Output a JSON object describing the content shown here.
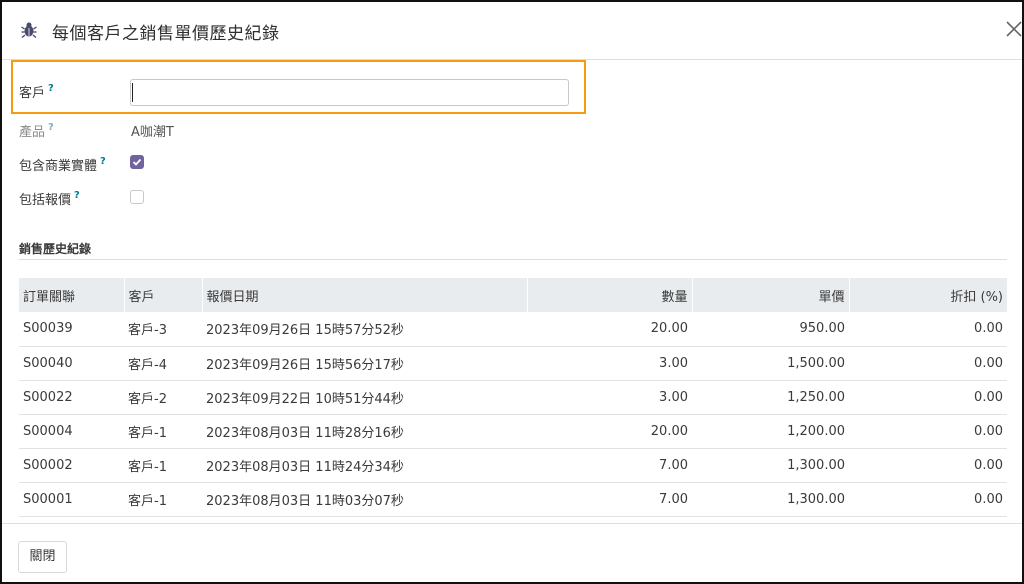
{
  "dialog": {
    "title": "每個客戶之銷售單價歷史紀錄"
  },
  "form": {
    "customer_label": "客戶",
    "customer_value": "",
    "product_label": "產品",
    "product_value": "A咖潮T",
    "include_company_label": "包含商業實體",
    "include_company_checked": true,
    "include_quotes_label": "包括報價",
    "include_quotes_checked": false,
    "help_mark": "?"
  },
  "history": {
    "section_title": "銷售歷史紀錄",
    "columns": [
      "訂單關聯",
      "客戶",
      "報價日期",
      "數量",
      "單價",
      "折扣 (%)"
    ],
    "rows": [
      {
        "order": "S00039",
        "customer": "客戶-3",
        "date": "2023年09月26日 15時57分52秒",
        "qty": "20.00",
        "price": "950.00",
        "discount": "0.00"
      },
      {
        "order": "S00040",
        "customer": "客戶-4",
        "date": "2023年09月26日 15時56分17秒",
        "qty": "3.00",
        "price": "1,500.00",
        "discount": "0.00"
      },
      {
        "order": "S00022",
        "customer": "客戶-2",
        "date": "2023年09月22日 10時51分44秒",
        "qty": "3.00",
        "price": "1,250.00",
        "discount": "0.00"
      },
      {
        "order": "S00004",
        "customer": "客戶-1",
        "date": "2023年08月03日 11時28分16秒",
        "qty": "20.00",
        "price": "1,200.00",
        "discount": "0.00"
      },
      {
        "order": "S00002",
        "customer": "客戶-1",
        "date": "2023年08月03日 11時24分34秒",
        "qty": "7.00",
        "price": "1,300.00",
        "discount": "0.00"
      },
      {
        "order": "S00001",
        "customer": "客戶-1",
        "date": "2023年08月03日 11時03分07秒",
        "qty": "7.00",
        "price": "1,300.00",
        "discount": "0.00"
      }
    ]
  },
  "footer": {
    "close_label": "關閉"
  },
  "colors": {
    "accent_checkbox": "#71639e",
    "help_mark": "#017e84",
    "highlight_border": "#f39c12"
  },
  "icons": {
    "header_icon": "bug-icon",
    "close_icon": "close-icon"
  }
}
